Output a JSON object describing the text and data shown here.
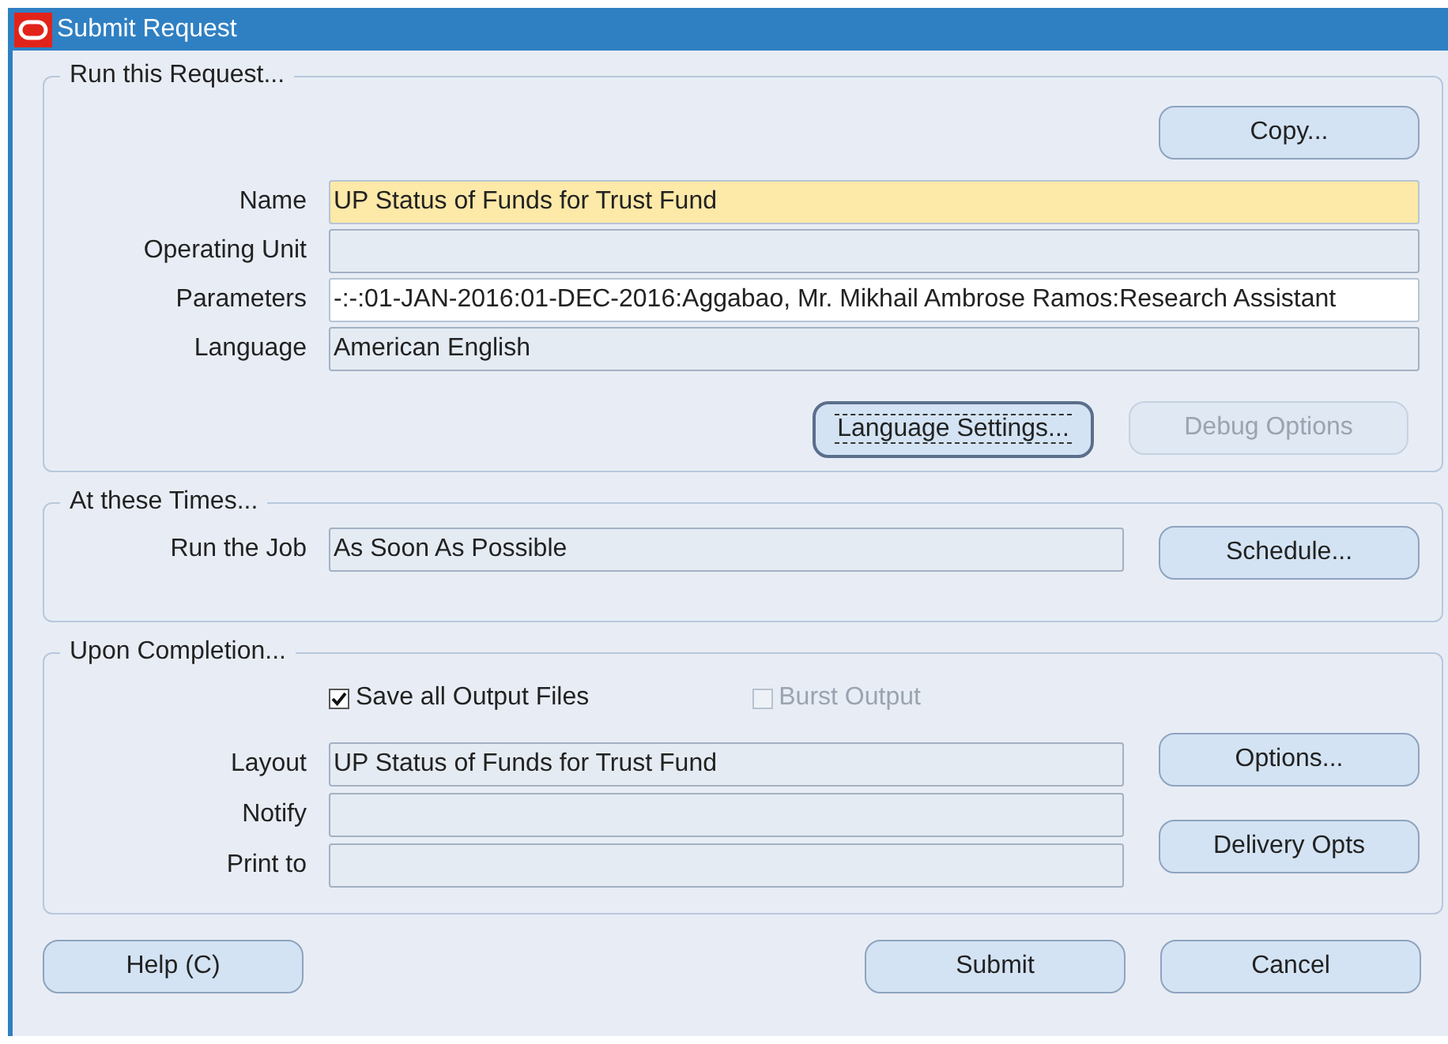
{
  "window": {
    "title": "Submit Request"
  },
  "run_request": {
    "legend": "Run this Request...",
    "copy_button": {
      "label": "Copy..."
    },
    "fields": [
      {
        "label": "Name",
        "value": "UP Status of Funds for Trust Fund",
        "kind": "required"
      },
      {
        "label": "Operating Unit",
        "kind": "readonly"
      },
      {
        "label": "Parameters",
        "value": "-:-:01-JAN-2016:01-DEC-2016:Aggabao, Mr. Mikhail Ambrose Ramos:Research Assistant",
        "kind": "editable"
      },
      {
        "label": "Language",
        "value": "American English",
        "kind": "readonly"
      }
    ],
    "buttons": [
      {
        "label": "Language Settings...",
        "focused": true,
        "disabled": false
      },
      {
        "label": "Debug Options",
        "focused": false,
        "disabled": true
      }
    ]
  },
  "at_these_times": {
    "legend": "At these Times...",
    "field": {
      "label": "Run the Job",
      "value": "As Soon As Possible",
      "kind": "readonly"
    },
    "schedule_button": {
      "label": "Schedule..."
    }
  },
  "upon_completion": {
    "legend": "Upon Completion...",
    "checkboxes": [
      {
        "label": "Save all Output Files",
        "checked": true,
        "disabled": false
      },
      {
        "label": "Burst Output",
        "checked": false,
        "disabled": true
      }
    ],
    "fields": [
      {
        "label": "Layout",
        "value": "UP Status of Funds for Trust Fund",
        "kind": "readonly"
      },
      {
        "label": "Notify",
        "kind": "readonly"
      },
      {
        "label": "Print to",
        "kind": "readonly"
      }
    ],
    "buttons": [
      {
        "label": "Options..."
      },
      {
        "label": "Delivery Opts"
      }
    ]
  },
  "footer_buttons": [
    {
      "label": "Help (C)"
    },
    {
      "label": "Submit"
    },
    {
      "label": "Cancel"
    }
  ]
}
